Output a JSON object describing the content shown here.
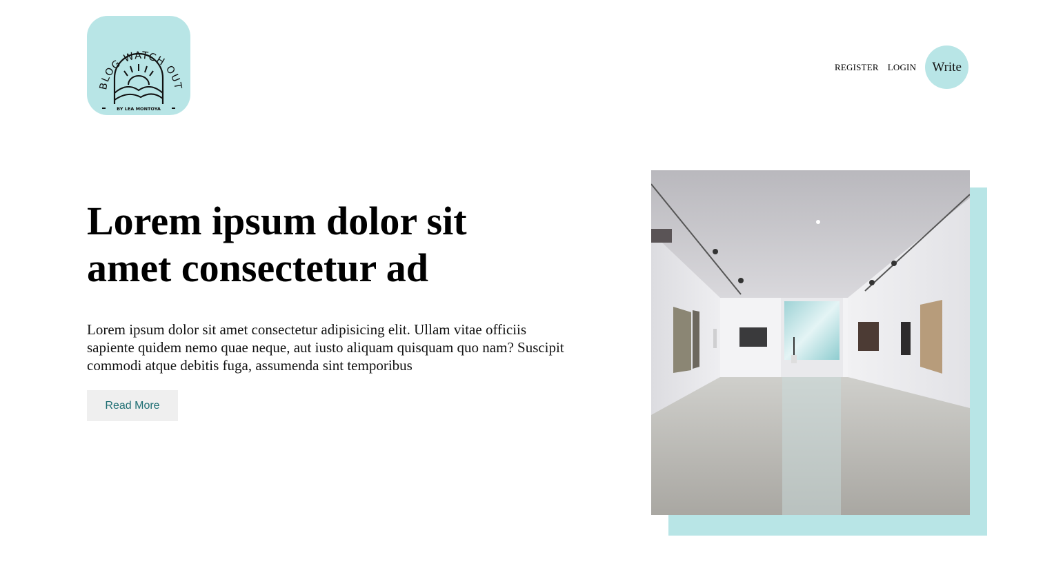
{
  "logo": {
    "arc_text": "BLOG WATCH OUT",
    "byline": "BY LEA MONTOYA",
    "color": "#b8e5e6"
  },
  "nav": {
    "register": "REGISTER",
    "login": "LOGIN",
    "write": "Write"
  },
  "hero": {
    "title": "Lorem ipsum dolor sit amet consectetur ad",
    "text": "Lorem ipsum dolor sit amet consectetur adipisicing elit. Ullam vitae officiis sapiente quidem nemo quae neque, aut iusto aliquam quisquam quo nam? Suscipit commodi atque debitis fuga, assumenda sint temporibus",
    "button": "Read More"
  },
  "colors": {
    "accent": "#b8e5e6",
    "button_text": "#1e6e73",
    "button_bg": "#efefef"
  }
}
